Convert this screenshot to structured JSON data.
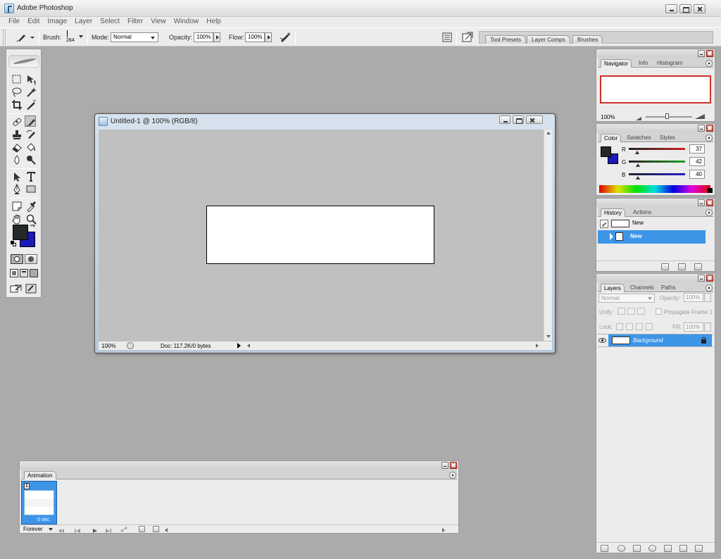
{
  "app": {
    "title": "Adobe Photoshop"
  },
  "menu": [
    "File",
    "Edit",
    "Image",
    "Layer",
    "Select",
    "Filter",
    "View",
    "Window",
    "Help"
  ],
  "options_bar": {
    "brush_label": "Brush:",
    "brush_size": "264",
    "mode_label": "Mode:",
    "mode_value": "Normal",
    "opacity_label": "Opacity:",
    "opacity_value": "100%",
    "flow_label": "Flow:",
    "flow_value": "100%",
    "palette_well_tabs": [
      "Tool Presets",
      "Layer Comps",
      "Brushes"
    ]
  },
  "toolbox": {
    "foreground_color": "#252828",
    "background_color": "#1a1ab8"
  },
  "document": {
    "title": "Untitled-1 @ 100% (RGB/8)",
    "zoom": "100%",
    "doc_info": "Doc: 117.2K/0 bytes"
  },
  "navigator_panel": {
    "tabs": [
      "Navigator",
      "Info",
      "Histogram"
    ],
    "zoom": "100%",
    "view_box_color": "#d0302a"
  },
  "color_panel": {
    "tabs": [
      "Color",
      "Swatches",
      "Styles"
    ],
    "channels": [
      {
        "label": "R",
        "value": 37,
        "display": "37",
        "color": "#cc2020"
      },
      {
        "label": "G",
        "value": 42,
        "display": "42",
        "color": "#20a020"
      },
      {
        "label": "B",
        "value": 40,
        "display": "40",
        "color": "#2020cc"
      }
    ]
  },
  "history_panel": {
    "tabs": [
      "History",
      "Actions"
    ],
    "snapshot_label": "New",
    "items": [
      "New"
    ],
    "selected_color": "#3d95e8"
  },
  "layers_panel": {
    "tabs": [
      "Layers",
      "Channels",
      "Paths"
    ],
    "blend_mode": "Normal",
    "opacity_label": "Opacity:",
    "opacity_value": "100%",
    "unify_label": "Unify:",
    "propagate_label": "Propagate Frame 1",
    "lock_label": "Lock:",
    "fill_label": "Fill:",
    "fill_value": "100%",
    "layers": [
      {
        "name": "Background",
        "visible": true,
        "locked": true
      }
    ]
  },
  "animation_panel": {
    "tab": "Animation",
    "frames": [
      {
        "number": "1",
        "delay": "0 sec."
      }
    ],
    "loop": "Forever"
  }
}
